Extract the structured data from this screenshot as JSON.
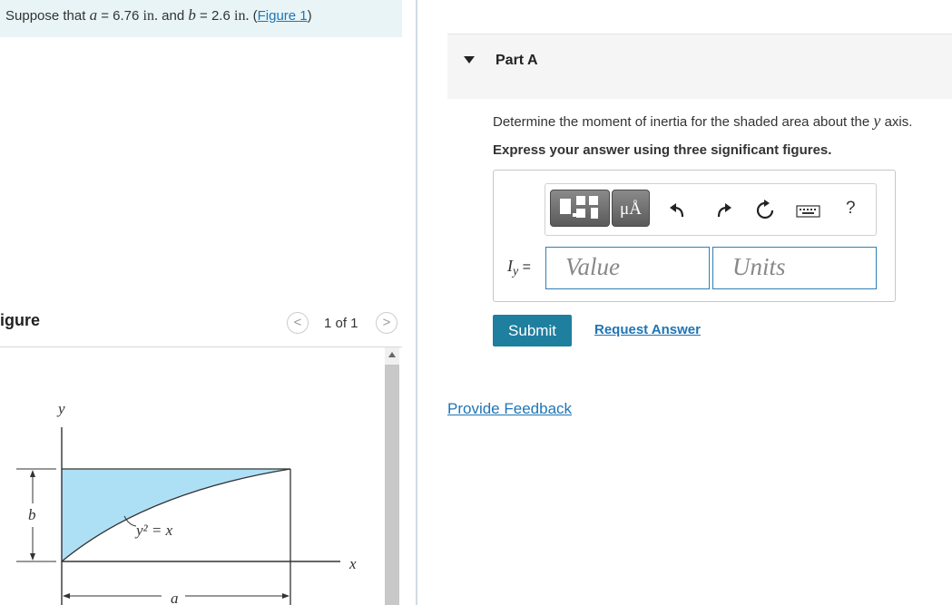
{
  "problem": {
    "prefix": "Suppose that ",
    "a_var": "a",
    "a_eq": " = 6.76 ",
    "a_unit": "in.",
    "mid": " and ",
    "b_var": "b",
    "b_eq": " = 2.6 ",
    "b_unit": "in.",
    "open_paren": " (",
    "figure_link": "Figure 1",
    "close_paren": ")"
  },
  "figure": {
    "title": "igure",
    "pager_text": "1 of 1",
    "prev_symbol": "<",
    "next_symbol": ">",
    "labels": {
      "y_axis": "y",
      "x_axis": "x",
      "b": "b",
      "a": "a",
      "curve": "y² = x"
    },
    "fill_color": "#aee0f5"
  },
  "part": {
    "title": "Part A",
    "question_prefix": "Determine the moment of inertia for the shaded area about the ",
    "question_var": "y",
    "question_suffix": " axis.",
    "instruction": "Express your answer using three significant figures."
  },
  "answer": {
    "lhs": "I",
    "lhs_sub": "y",
    "lhs_eq": " =",
    "value_placeholder": "Value",
    "units_placeholder": "Units",
    "toolbar": {
      "templates_icon": "templates-icon",
      "units_label": "μÅ",
      "undo_icon": "undo-icon",
      "redo_icon": "redo-icon",
      "reset_icon": "reset-icon",
      "keyboard_icon": "keyboard-icon",
      "help_label": "?"
    }
  },
  "actions": {
    "submit": "Submit",
    "request_answer": "Request Answer",
    "provide_feedback": "Provide Feedback"
  },
  "colors": {
    "accent": "#1e7f9f",
    "link": "#1f75b5",
    "problem_bg": "#e8f4f6"
  }
}
